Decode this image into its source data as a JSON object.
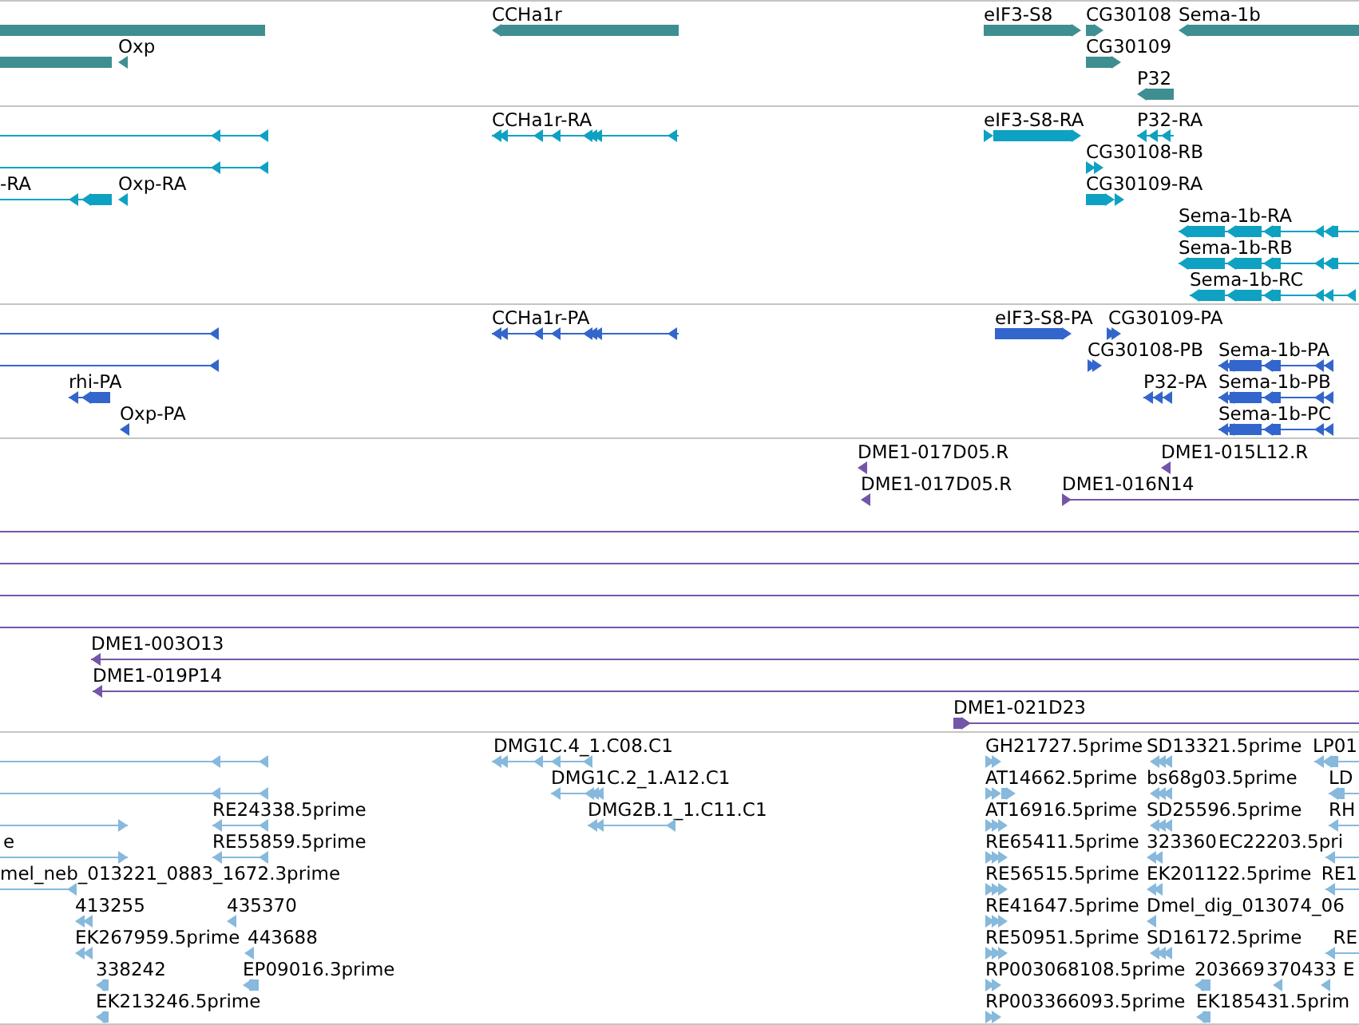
{
  "tracks": [
    {
      "color": "#3e8e92",
      "features": [
        {
          "kind": "bar"
        },
        {
          "kind": "bar",
          "label": "CCHa1r",
          "reverse": true
        },
        {
          "kind": "bar",
          "label": "eIF3-S8",
          "reverse": false
        },
        {
          "kind": "bar",
          "label": "CG30108",
          "reverse": false
        },
        {
          "kind": "bar",
          "label": "Sema-1b",
          "reverse": true
        },
        {
          "kind": "bar"
        },
        {
          "kind": "bar",
          "label": "Oxp",
          "reverse": true
        },
        {
          "kind": "bar",
          "label": "CG30109",
          "reverse": false
        },
        {
          "kind": "bar",
          "label": "P32",
          "reverse": true
        }
      ]
    },
    {
      "color": "#0ea1c2",
      "features": [
        {
          "kind": "gapped",
          "reverse": true
        },
        {
          "kind": "gapped",
          "label": "CCHa1r-RA",
          "reverse": true
        },
        {
          "kind": "gapped",
          "label": "eIF3-S8-RA",
          "reverse": false
        },
        {
          "kind": "gapped",
          "label": "P32-RA",
          "reverse": true
        },
        {
          "kind": "gapped",
          "reverse": true
        },
        {
          "kind": "gapped",
          "label": "CG30108-RB",
          "reverse": false
        },
        {
          "kind": "gapped",
          "label": "-RA",
          "reverse": true
        },
        {
          "kind": "gapped",
          "label": "Oxp-RA",
          "reverse": true
        },
        {
          "kind": "gapped",
          "label": "CG30109-RA",
          "reverse": false
        },
        {
          "kind": "gapped",
          "label": "Sema-1b-RA",
          "reverse": true
        },
        {
          "kind": "gapped",
          "label": "Sema-1b-RB",
          "reverse": true
        },
        {
          "kind": "gapped",
          "label": "Sema-1b-RC",
          "reverse": true
        }
      ]
    },
    {
      "color": "#3366cc",
      "features": [
        {
          "kind": "gapped",
          "reverse": true
        },
        {
          "kind": "gapped",
          "label": "CCHa1r-PA",
          "reverse": true
        },
        {
          "kind": "gapped",
          "label": "eIF3-S8-PA",
          "reverse": false
        },
        {
          "kind": "gapped",
          "label": "CG30109-PA",
          "reverse": false
        },
        {
          "kind": "gapped",
          "reverse": true
        },
        {
          "kind": "gapped",
          "label": "CG30108-PB",
          "reverse": false
        },
        {
          "kind": "gapped",
          "label": "Sema-1b-PA",
          "reverse": true
        },
        {
          "kind": "gapped",
          "label": "rhi-PA",
          "reverse": true
        },
        {
          "kind": "gapped",
          "label": "P32-PA",
          "reverse": true
        },
        {
          "kind": "gapped",
          "label": "Sema-1b-PB",
          "reverse": true
        },
        {
          "kind": "gapped",
          "label": "Oxp-PA",
          "reverse": true
        },
        {
          "kind": "gapped",
          "label": "Sema-1b-PC",
          "reverse": true
        }
      ]
    },
    {
      "color": "#7356a8",
      "features": [
        {
          "kind": "gapped",
          "label": "DME1-017D05.R",
          "reverse": true
        },
        {
          "kind": "gapped",
          "label": "DME1-015L12.R",
          "reverse": true
        },
        {
          "kind": "gapped",
          "label": "DME1-017D05.R",
          "reverse": true
        },
        {
          "kind": "gapped",
          "label": "DME1-016N14",
          "reverse": false
        },
        {
          "kind": "line"
        },
        {
          "kind": "line"
        },
        {
          "kind": "line"
        },
        {
          "kind": "line"
        },
        {
          "kind": "gapped",
          "label": "DME1-003O13",
          "reverse": true
        },
        {
          "kind": "gapped",
          "label": "DME1-019P14",
          "reverse": true
        },
        {
          "kind": "gapped",
          "label": "DME1-021D23",
          "reverse": false
        }
      ]
    },
    {
      "color": "#86b9dc",
      "features": [
        {
          "kind": "gapped",
          "reverse": true
        },
        {
          "kind": "gapped",
          "label": "DMG1C.4_1.C08.C1",
          "reverse": true
        },
        {
          "kind": "gapped",
          "label": "GH21727.5prime",
          "reverse": false
        },
        {
          "kind": "gapped",
          "label": "SD13321.5prime",
          "reverse": true
        },
        {
          "kind": "gapped",
          "label": "LP01",
          "reverse": true
        },
        {
          "kind": "gapped",
          "reverse": true
        },
        {
          "kind": "gapped",
          "label": "DMG1C.2_1.A12.C1",
          "reverse": true
        },
        {
          "kind": "gapped",
          "label": "AT14662.5prime",
          "reverse": false
        },
        {
          "kind": "gapped",
          "label": "bs68g03.5prime",
          "reverse": true
        },
        {
          "kind": "gapped",
          "label": "LD",
          "reverse": true
        },
        {
          "kind": "gapped",
          "reverse": false
        },
        {
          "kind": "gapped",
          "label": "RE24338.5prime",
          "reverse": true
        },
        {
          "kind": "gapped",
          "label": "DMG2B.1_1.C11.C1",
          "reverse": true
        },
        {
          "kind": "gapped",
          "label": "AT16916.5prime",
          "reverse": false
        },
        {
          "kind": "gapped",
          "label": "SD25596.5prime",
          "reverse": true
        },
        {
          "kind": "gapped",
          "label": "RH",
          "reverse": true
        },
        {
          "kind": "gapped",
          "label": "e",
          "reverse": false
        },
        {
          "kind": "gapped",
          "label": "RE55859.5prime",
          "reverse": true
        },
        {
          "kind": "gapped",
          "label": "RE65411.5prime",
          "reverse": false
        },
        {
          "kind": "gapped",
          "label": "323360",
          "reverse": true
        },
        {
          "kind": "gapped",
          "label": "EC22203.5pri",
          "reverse": true
        },
        {
          "kind": "gapped",
          "label": "mel_neb_013221_0883_1672.3prime",
          "reverse": true
        },
        {
          "kind": "gapped",
          "label": "RE56515.5prime",
          "reverse": false
        },
        {
          "kind": "gapped",
          "label": "EK201122.5prime",
          "reverse": true
        },
        {
          "kind": "gapped",
          "label": "RE1",
          "reverse": true
        },
        {
          "kind": "gapped",
          "label": "413255",
          "reverse": true
        },
        {
          "kind": "gapped",
          "label": "435370",
          "reverse": true
        },
        {
          "kind": "gapped",
          "label": "RE41647.5prime",
          "reverse": false
        },
        {
          "kind": "gapped",
          "label": "Dmel_dig_013074_06",
          "reverse": true
        },
        {
          "kind": "gapped",
          "label": "EK267959.5prime",
          "reverse": true
        },
        {
          "kind": "gapped",
          "label": "443688",
          "reverse": true
        },
        {
          "kind": "gapped",
          "label": "RE50951.5prime",
          "reverse": false
        },
        {
          "kind": "gapped",
          "label": "SD16172.5prime",
          "reverse": true
        },
        {
          "kind": "gapped",
          "label": "RE",
          "reverse": true
        },
        {
          "kind": "gapped",
          "label": "338242",
          "reverse": true
        },
        {
          "kind": "gapped",
          "label": "EP09016.3prime",
          "reverse": true
        },
        {
          "kind": "gapped",
          "label": "RP003068108.5prime",
          "reverse": false
        },
        {
          "kind": "gapped",
          "label": "203669",
          "reverse": true
        },
        {
          "kind": "gapped",
          "label": "370433",
          "reverse": true
        },
        {
          "kind": "gapped",
          "label": "E",
          "reverse": true
        },
        {
          "kind": "gapped",
          "label": "EK213246.5prime",
          "reverse": true
        },
        {
          "kind": "gapped",
          "label": "RP003366093.5prime",
          "reverse": false
        },
        {
          "kind": "gapped",
          "label": "EK185431.5prim",
          "reverse": true
        }
      ]
    }
  ]
}
